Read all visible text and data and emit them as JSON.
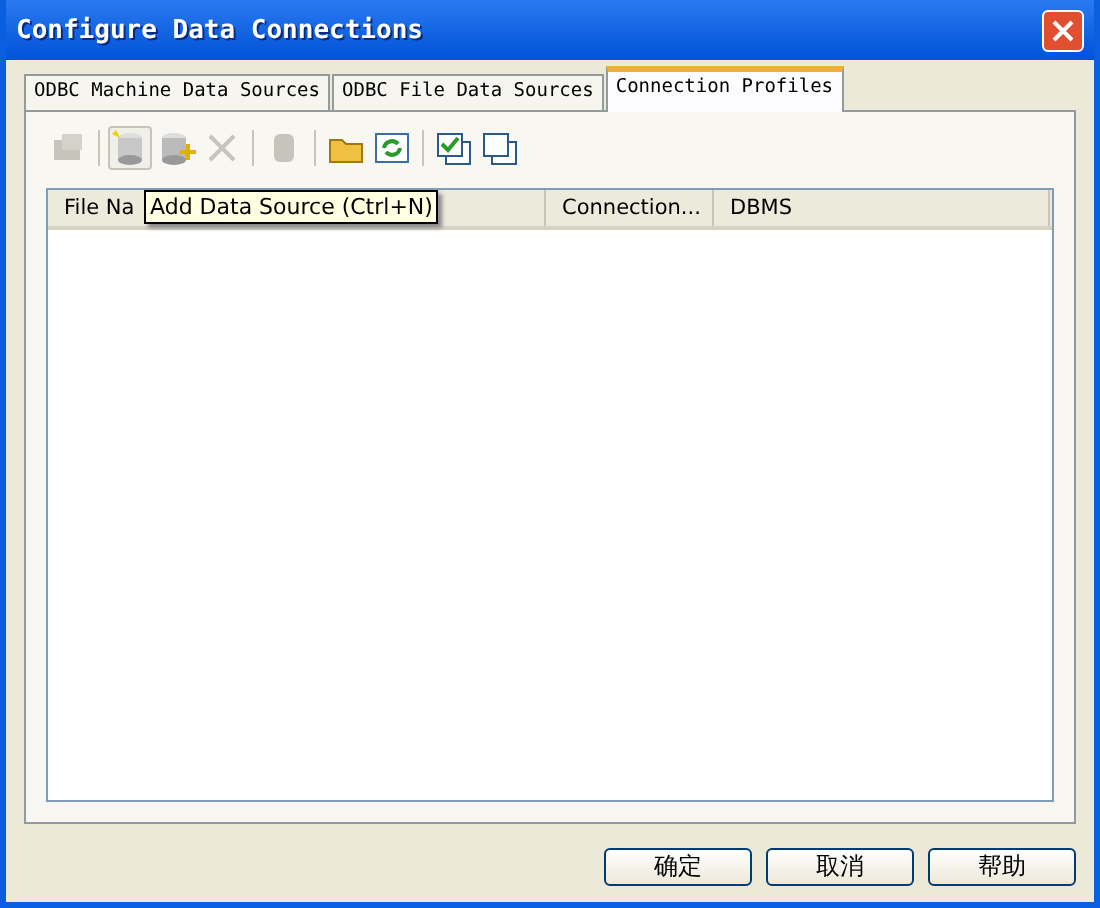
{
  "window": {
    "title": "Configure Data Connections"
  },
  "tabs": [
    {
      "label": "ODBC Machine Data Sources",
      "selected": false
    },
    {
      "label": "ODBC File Data Sources",
      "selected": false
    },
    {
      "label": "Connection Profiles",
      "selected": true
    }
  ],
  "toolbar": [
    {
      "kind": "properties",
      "disabled": true,
      "hovered": false
    },
    {
      "kind": "separator"
    },
    {
      "kind": "new-source",
      "disabled": false,
      "hovered": true
    },
    {
      "kind": "add-source",
      "disabled": false,
      "hovered": false
    },
    {
      "kind": "delete",
      "disabled": true,
      "hovered": false
    },
    {
      "kind": "separator"
    },
    {
      "kind": "database",
      "disabled": true,
      "hovered": false
    },
    {
      "kind": "separator"
    },
    {
      "kind": "folder",
      "disabled": false,
      "hovered": false
    },
    {
      "kind": "refresh",
      "disabled": false,
      "hovered": false
    },
    {
      "kind": "separator"
    },
    {
      "kind": "check",
      "disabled": false,
      "hovered": false
    },
    {
      "kind": "windows",
      "disabled": false,
      "hovered": false
    }
  ],
  "tooltip": "Add Data Source (Ctrl+N)",
  "table": {
    "columns": [
      "File Na",
      "Connection...",
      "DBMS"
    ]
  },
  "buttons": [
    "确定",
    "取消",
    "帮助"
  ]
}
